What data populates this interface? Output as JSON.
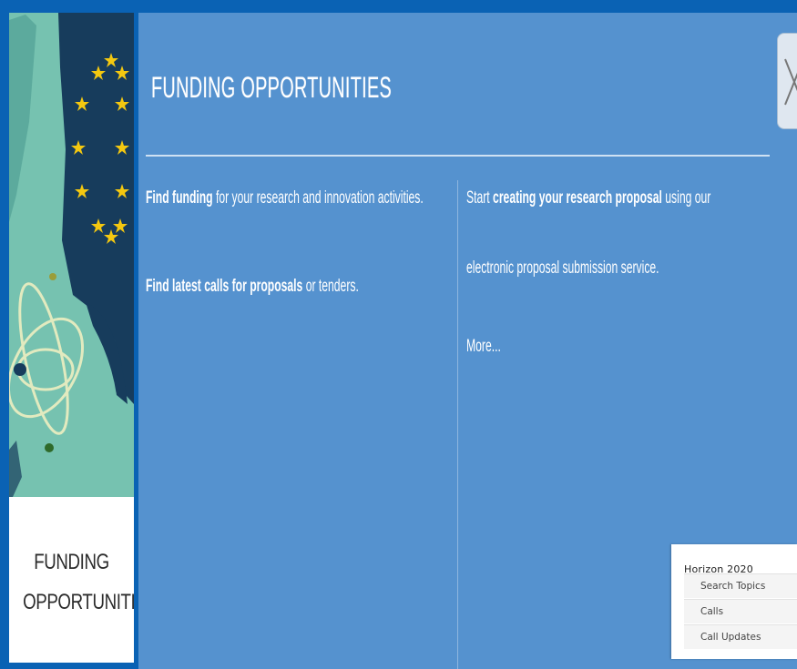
{
  "banner": {
    "title_line1": "FUNDING",
    "title_line2": "OPPORTUNITIES"
  },
  "panel": {
    "title": "FUNDING OPPORTUNITIES",
    "close_icon": "close-icon",
    "left_col": {
      "line1": {
        "link": "Find funding",
        "rest": " for your research and innovation activities."
      },
      "line2": {
        "prefix": "Find ",
        "link": "latest calls for proposals",
        "rest": " or tenders."
      }
    },
    "right_col": {
      "line1": {
        "prefix": "Start ",
        "bold1": "creating",
        "bold2": " your research proposal",
        "rest": " using our"
      },
      "line2": "electronic proposal submission service.",
      "more": "More..."
    }
  },
  "horizon": {
    "title": "Horizon 2020",
    "items": [
      "Search Topics",
      "Calls",
      "Call Updates"
    ]
  },
  "colors": {
    "background": "#0a62b4",
    "panel": "#5592cf",
    "banner_art": "#76c2b0",
    "eu_dark": "#173c5c",
    "star": "#f4c810"
  }
}
